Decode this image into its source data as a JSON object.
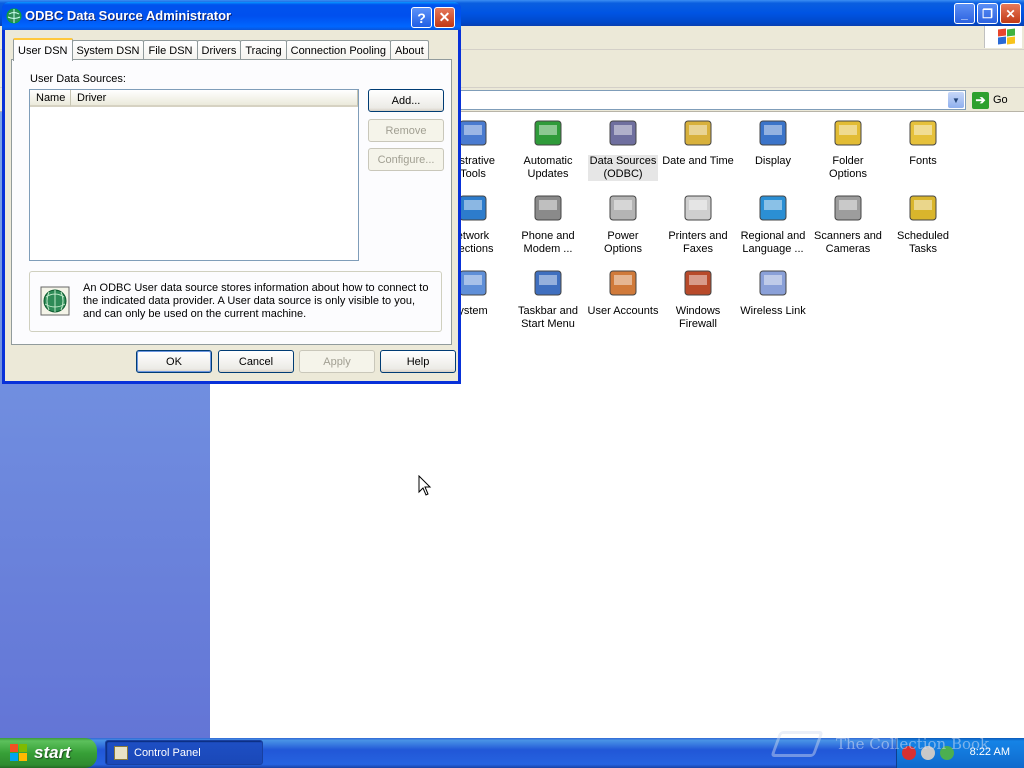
{
  "colors": {
    "title_blue": "#0054e3",
    "dialog_face": "#ece9d8",
    "taskbar_blue": "#245edb",
    "start_green": "#37a037",
    "sidebar_top": "#7ba2e7",
    "sidebar_bottom": "#6375d6"
  },
  "control_panel": {
    "address_go": "Go",
    "items": [
      {
        "label": "nistrative\nTools",
        "icon": "administrative-tools-icon",
        "selected": false
      },
      {
        "label": "Automatic\nUpdates",
        "icon": "automatic-updates-icon",
        "selected": false
      },
      {
        "label": "Data Sources\n(ODBC)",
        "icon": "data-sources-icon",
        "selected": true
      },
      {
        "label": "Date and Time",
        "icon": "date-time-icon",
        "selected": false
      },
      {
        "label": "Display",
        "icon": "display-icon",
        "selected": false
      },
      {
        "label": "Folder Options",
        "icon": "folder-options-icon",
        "selected": false
      },
      {
        "label": "Fonts",
        "icon": "fonts-icon",
        "selected": false
      },
      {
        "label": "etwork\nnections",
        "icon": "network-connections-icon",
        "selected": false
      },
      {
        "label": "Phone and\nModem ...",
        "icon": "phone-modem-icon",
        "selected": false
      },
      {
        "label": "Power Options",
        "icon": "power-options-icon",
        "selected": false
      },
      {
        "label": "Printers and\nFaxes",
        "icon": "printers-faxes-icon",
        "selected": false
      },
      {
        "label": "Regional and\nLanguage ...",
        "icon": "regional-language-icon",
        "selected": false
      },
      {
        "label": "Scanners and\nCameras",
        "icon": "scanners-cameras-icon",
        "selected": false
      },
      {
        "label": "Scheduled\nTasks",
        "icon": "scheduled-tasks-icon",
        "selected": false
      },
      {
        "label": "ystem",
        "icon": "system-icon",
        "selected": false
      },
      {
        "label": "Taskbar and\nStart Menu",
        "icon": "taskbar-start-menu-icon",
        "selected": false
      },
      {
        "label": "User Accounts",
        "icon": "user-accounts-icon",
        "selected": false
      },
      {
        "label": "Windows\nFirewall",
        "icon": "windows-firewall-icon",
        "selected": false
      },
      {
        "label": "Wireless Link",
        "icon": "wireless-link-icon",
        "selected": false
      }
    ]
  },
  "dialog": {
    "title": "ODBC Data Source Administrator",
    "help_glyph": "?",
    "close_glyph": "✕",
    "tabs": [
      "User DSN",
      "System DSN",
      "File DSN",
      "Drivers",
      "Tracing",
      "Connection Pooling",
      "About"
    ],
    "active_tab": "User DSN",
    "group_label": "User Data Sources:",
    "columns": [
      "Name",
      "Driver"
    ],
    "buttons": {
      "add": "Add...",
      "remove": "Remove",
      "configure": "Configure...",
      "ok": "OK",
      "cancel": "Cancel",
      "apply": "Apply",
      "help": "Help"
    },
    "info_text": "An ODBC User data source stores information about how to connect to the indicated data provider.   A User data source is only visible to you, and can only be used on the current machine."
  },
  "taskbar": {
    "start_label": "start",
    "task_label": "Control Panel",
    "clock": "8:22 AM",
    "watermark": "The Collection Book"
  }
}
